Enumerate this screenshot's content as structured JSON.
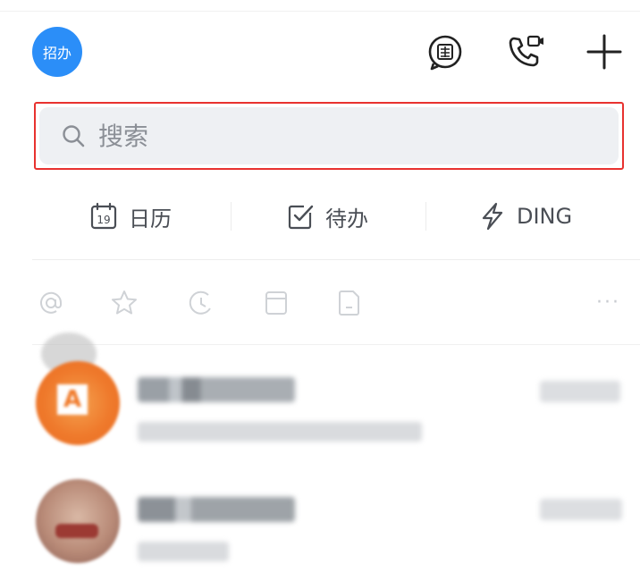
{
  "header": {
    "avatar_text": "招办",
    "avatar_color": "#2b8ef8",
    "icons": [
      "moments-icon",
      "video-call-icon",
      "plus-icon"
    ]
  },
  "search": {
    "placeholder": "搜索",
    "highlight_color": "#e8322f"
  },
  "quick_actions": [
    {
      "label": "日历",
      "icon": "calendar-icon",
      "calendar_day": "19"
    },
    {
      "label": "待办",
      "icon": "checkbox-icon"
    },
    {
      "label": "DING",
      "icon": "lightning-icon"
    }
  ],
  "filter_tabs": {
    "icons": [
      "mention-icon",
      "star-icon",
      "history-icon",
      "folder-icon",
      "document-icon"
    ],
    "more_label": "···"
  },
  "conversations": [
    {
      "avatar_letter": "A",
      "avatar_color": "#f07a2a",
      "name": "",
      "message": "",
      "time": ""
    },
    {
      "avatar_letter": "",
      "avatar_color": "#c7a08a",
      "name": "",
      "message": "",
      "time": ""
    }
  ]
}
